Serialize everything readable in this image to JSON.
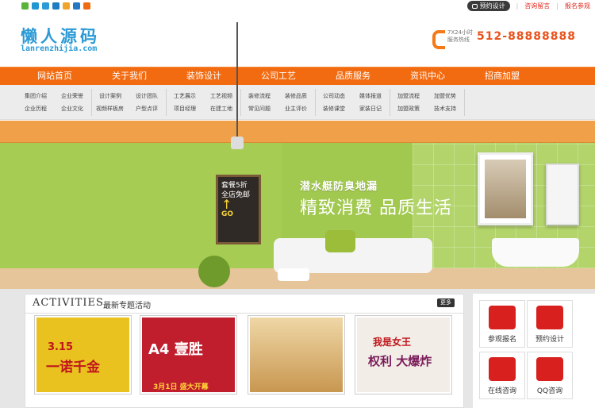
{
  "topbar": {
    "share_colors": [
      "#58b53a",
      "#2196d3",
      "#2c9ad6",
      "#1f7cc2",
      "#f0a52a",
      "#2677c3",
      "#f06c12"
    ],
    "appointment": "预约设计",
    "message": "咨询留言",
    "signup": "报名参观"
  },
  "header": {
    "logo_cn": "懒人源码",
    "logo_en": "lanrenzhijia.com",
    "hotline_small_1": "7X24小时",
    "hotline_small_2": "服务热线",
    "phone": "512-88888888"
  },
  "nav": [
    "网站首页",
    "关于我们",
    "装饰设计",
    "公司工艺",
    "品质服务",
    "资讯中心",
    "招商加盟"
  ],
  "subnav": [
    [
      "集团介绍",
      "企业荣誉",
      "企业历程",
      "企业文化"
    ],
    [
      "设计案例",
      "设计团队",
      "视频样板房",
      "户型点评"
    ],
    [
      "工艺展示",
      "工艺视频",
      "项目经理",
      "在建工地"
    ],
    [
      "装修流程",
      "装修品质",
      "常见问题",
      "业主评价"
    ],
    [
      "公司动态",
      "媒体报道",
      "装修课堂",
      "家装日记"
    ],
    [
      "加盟流程",
      "加盟优势",
      "加盟政策",
      "技术支持"
    ]
  ],
  "banner": {
    "board_line1": "套餐5折",
    "board_line2": "全店免邮",
    "board_go": "GO",
    "tagline1": "潜水艇防臭地漏",
    "tagline2": "精致消费 品质生活"
  },
  "activities": {
    "title": "ACTIVITIES",
    "subtitle": "最新专题活动",
    "more": "更多",
    "thumbs": [
      {
        "line1": "3.15",
        "line2": "一诺千金"
      },
      {
        "line1": "A4 壹胜",
        "line2": "3月1日 盛大开幕"
      },
      {
        "line1": "",
        "line2": ""
      },
      {
        "line1": "我是女王",
        "line2": "权利 大爆炸"
      }
    ]
  },
  "services": [
    "参观报名",
    "预约设计",
    "在线咨询",
    "QQ咨询"
  ]
}
